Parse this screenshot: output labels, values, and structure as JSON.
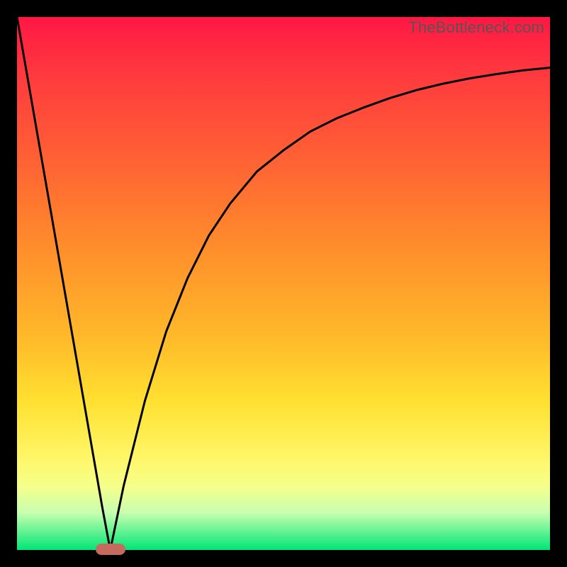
{
  "watermark": "TheBottleneck.com",
  "colors": {
    "frame": "#000000",
    "gradient_top": "#ff1744",
    "gradient_mid": "#ffe030",
    "gradient_bottom": "#00e676",
    "curve": "#000000",
    "marker": "#c66a5e"
  },
  "chart_data": {
    "type": "line",
    "title": "",
    "xlabel": "",
    "ylabel": "",
    "xlim": [
      0,
      100
    ],
    "ylim": [
      0,
      100
    ],
    "grid": false,
    "legend": false,
    "series": [
      {
        "name": "left-branch",
        "x": [
          0,
          4,
          8,
          12,
          16,
          17.5
        ],
        "y": [
          100,
          77,
          54,
          31,
          8,
          0
        ]
      },
      {
        "name": "right-branch",
        "x": [
          17.5,
          20,
          24,
          28,
          32,
          36,
          40,
          45,
          50,
          55,
          60,
          65,
          70,
          75,
          80,
          85,
          90,
          95,
          100
        ],
        "y": [
          0,
          12,
          28,
          41,
          51,
          59,
          65,
          71,
          75,
          78.5,
          81,
          83,
          84.8,
          86.3,
          87.5,
          88.5,
          89.3,
          90,
          90.5
        ]
      }
    ],
    "marker": {
      "x": 17.5,
      "y": 0,
      "width_pct": 5.6,
      "height_pct": 2.1
    },
    "background_gradient": {
      "direction": "top-to-bottom",
      "stops": [
        {
          "pct": 0,
          "color": "#ff1744"
        },
        {
          "pct": 50,
          "color": "#ffb92a"
        },
        {
          "pct": 85,
          "color": "#fff564"
        },
        {
          "pct": 100,
          "color": "#00e676"
        }
      ]
    }
  }
}
